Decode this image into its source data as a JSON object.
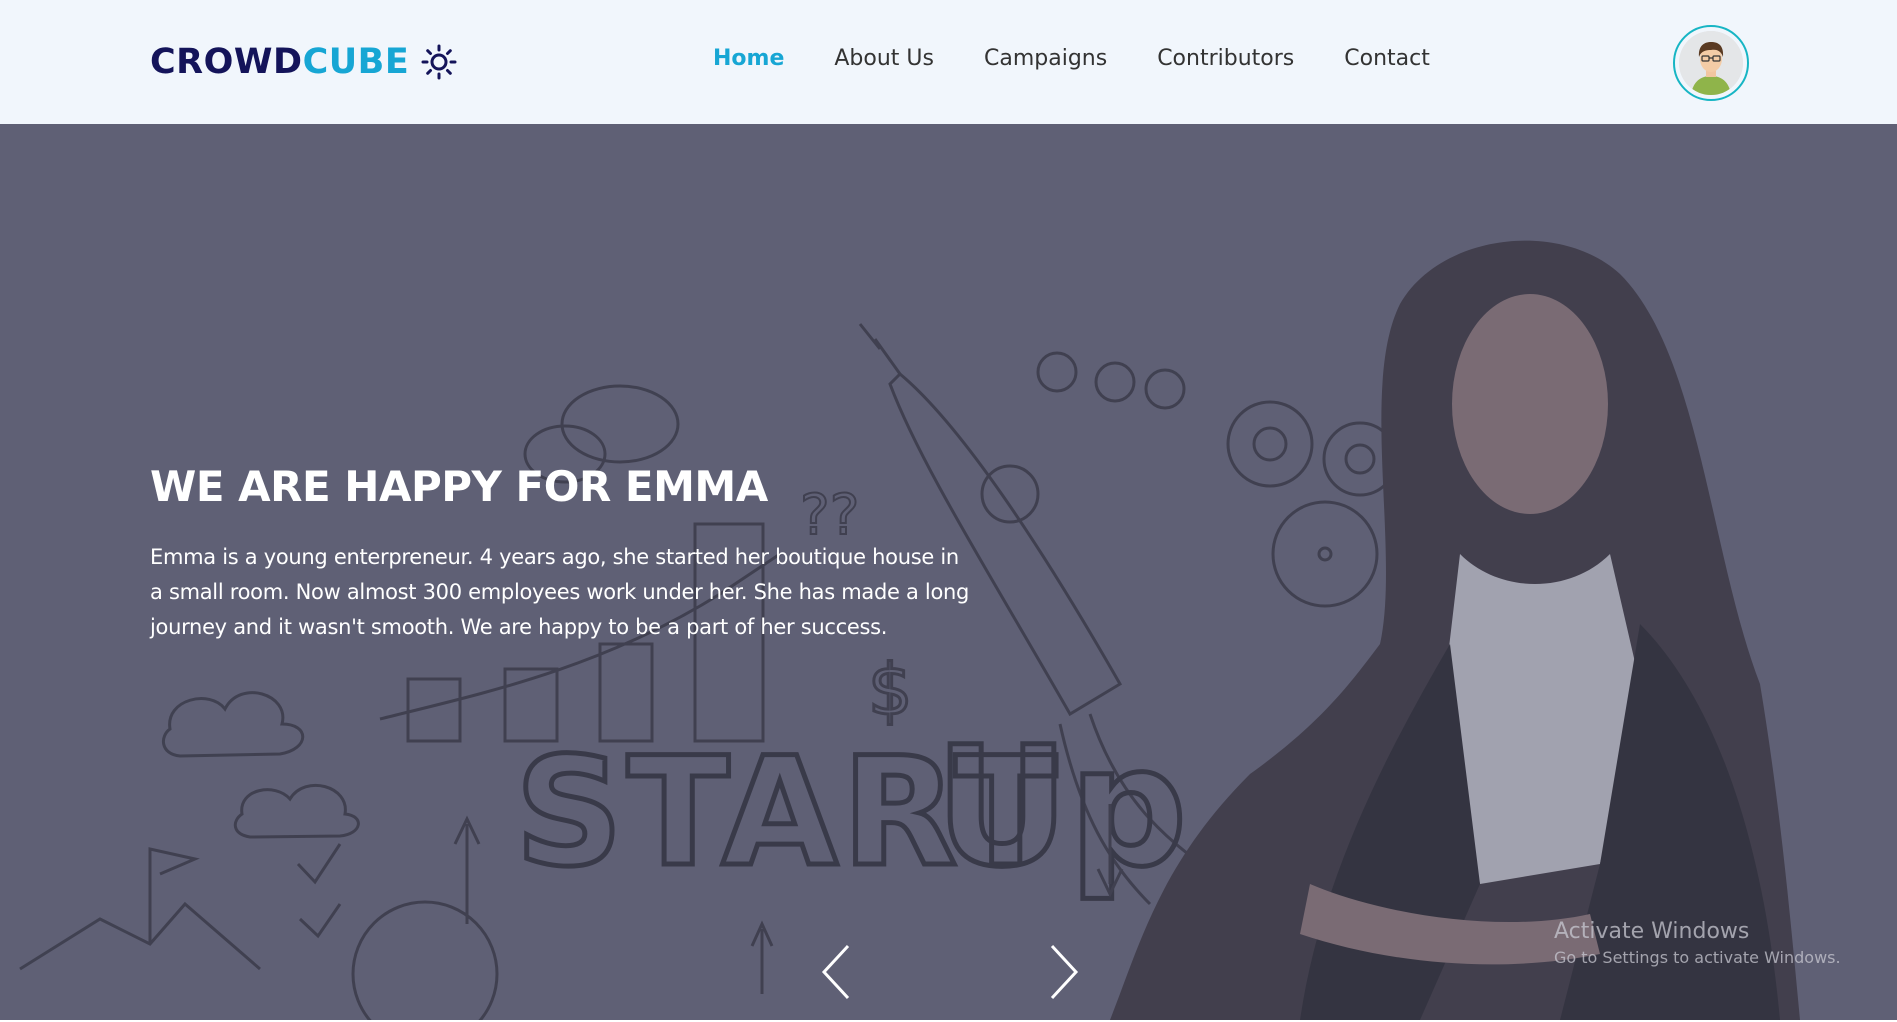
{
  "header": {
    "logo_part1": "CROWD",
    "logo_part2": "CUBE",
    "logo_icon": "sun-icon",
    "nav": [
      {
        "label": "Home",
        "active": true
      },
      {
        "label": "About Us",
        "active": false
      },
      {
        "label": "Campaigns",
        "active": false
      },
      {
        "label": "Contributors",
        "active": false
      },
      {
        "label": "Contact",
        "active": false
      }
    ],
    "avatar_icon": "user-avatar-icon"
  },
  "hero": {
    "title": "WE ARE HAPPY FOR EMMA",
    "text": "Emma is a young enterpreneur. 4 years ago, she started her boutique house in a small room. Now almost 300 employees work under her. She has made a long journey and it wasn't smooth. We are happy to be a part of her success.",
    "background_text": "STARTUP",
    "prev_icon": "chevron-left-icon",
    "next_icon": "chevron-right-icon"
  },
  "watermark": {
    "line1": "Activate Windows",
    "line2": "Go to Settings to activate Windows."
  },
  "colors": {
    "accent": "#17a6d4",
    "logo_dark": "#14145a",
    "navbar_bg": "#f1f6fc",
    "hero_overlay": "#606276"
  }
}
